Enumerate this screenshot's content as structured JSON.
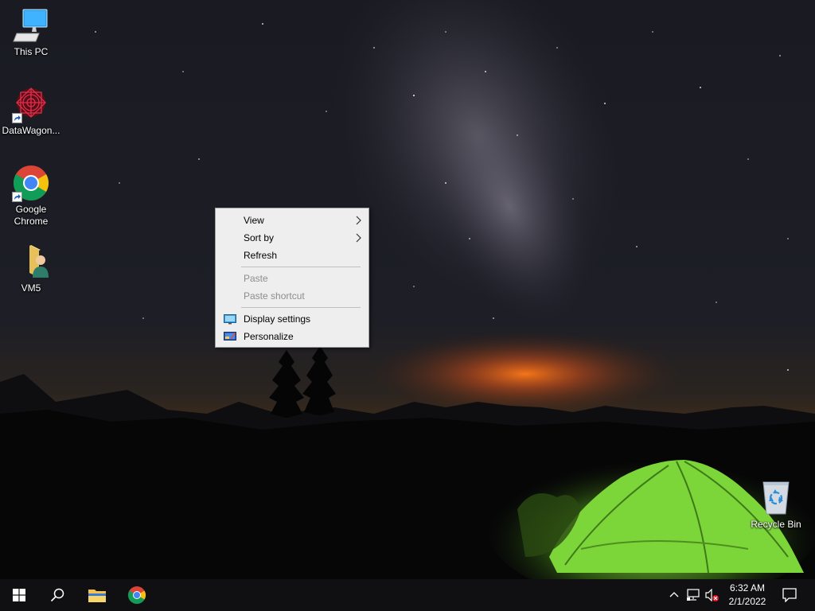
{
  "desktop": {
    "icons": [
      {
        "label": "This PC",
        "icon": "this-pc-icon"
      },
      {
        "label": "DataWagon...",
        "icon": "datawagon-icon"
      },
      {
        "label": "Google Chrome",
        "icon": "chrome-icon"
      },
      {
        "label": "VM5",
        "icon": "user-folder-icon"
      },
      {
        "label": "Recycle Bin",
        "icon": "recycle-bin-icon"
      }
    ]
  },
  "context_menu": {
    "items": [
      {
        "label": "View",
        "submenu": true,
        "enabled": true
      },
      {
        "label": "Sort by",
        "submenu": true,
        "enabled": true
      },
      {
        "label": "Refresh",
        "enabled": true
      },
      {
        "label": "Paste",
        "enabled": false
      },
      {
        "label": "Paste shortcut",
        "enabled": false
      },
      {
        "label": "Display settings",
        "enabled": true,
        "icon": "display-settings-icon"
      },
      {
        "label": "Personalize",
        "enabled": true,
        "icon": "personalize-icon"
      }
    ]
  },
  "taskbar": {
    "buttons": [
      "start-icon",
      "search-icon",
      "file-explorer-icon",
      "chrome-icon"
    ],
    "tray": [
      "show-hidden-icons-chevron",
      "network-icon",
      "volume-muted-icon"
    ],
    "clock": {
      "time": "6:32 AM",
      "date": "2/1/2022"
    },
    "notification_icon": "action-center-icon"
  },
  "colors": {
    "menu_bg": "#eeeeee",
    "menu_disabled_text": "#8d8d8d",
    "taskbar_bg": "#101012",
    "tent_green": "#7cd63a"
  }
}
